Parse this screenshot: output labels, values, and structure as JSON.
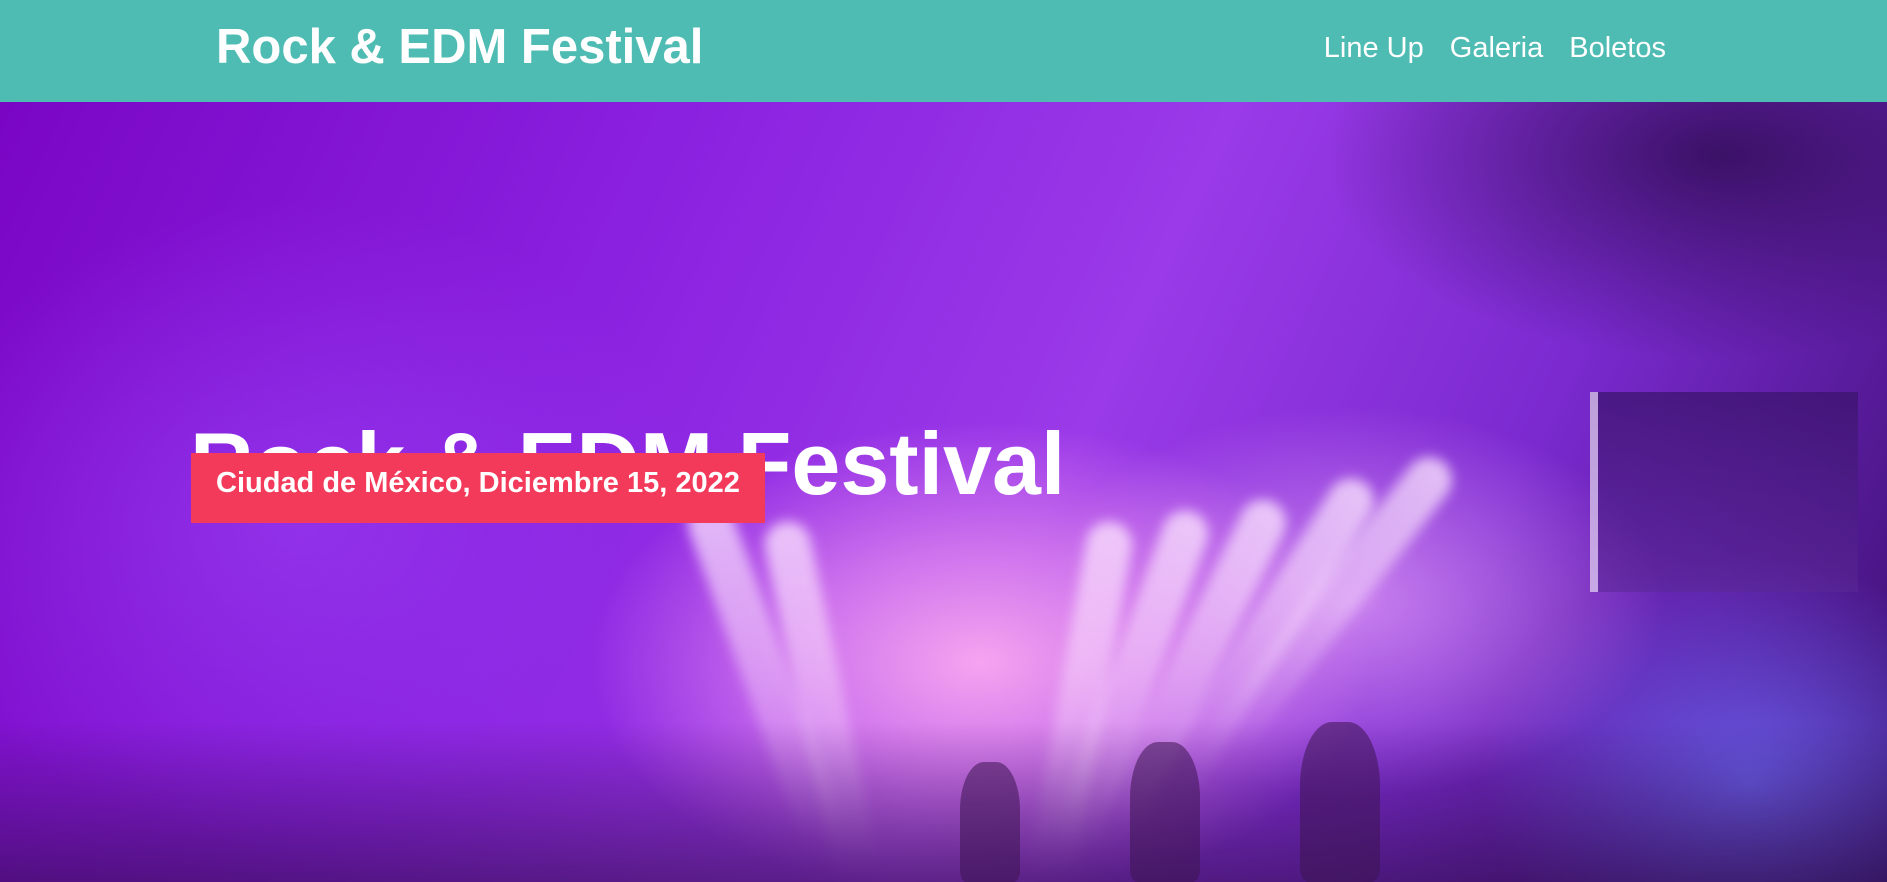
{
  "header": {
    "brand": "Rock & EDM Festival",
    "nav": [
      {
        "label": "Line Up"
      },
      {
        "label": "Galeria"
      },
      {
        "label": "Boletos"
      }
    ]
  },
  "hero": {
    "title": "Rock & EDM Festival",
    "date": "Ciudad de México, Diciembre 15, 2022"
  },
  "colors": {
    "header_bg": "#4fbcb4",
    "date_badge_bg": "#f43a5a",
    "hero_accent": "#8a20e0"
  }
}
